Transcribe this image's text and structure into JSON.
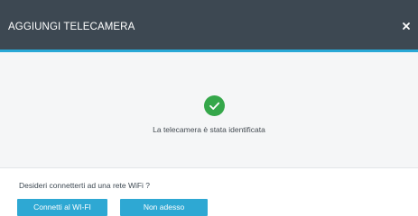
{
  "dialog": {
    "title": "AGGIUNGI TELECAMERA",
    "close_icon": "close-icon"
  },
  "status": {
    "icon": "check-circle-icon",
    "accent_color": "#35a74a",
    "message": "La telecamera è stata identificata"
  },
  "wifi_prompt": {
    "question": "Desideri connetterti ad una rete WiFi ?",
    "connect_label": "Connetti al WI-FI",
    "later_label": "Non adesso"
  },
  "colors": {
    "header_bg": "#3d4852",
    "header_accent": "#29a8d6",
    "button_bg": "#2ea8d3"
  }
}
